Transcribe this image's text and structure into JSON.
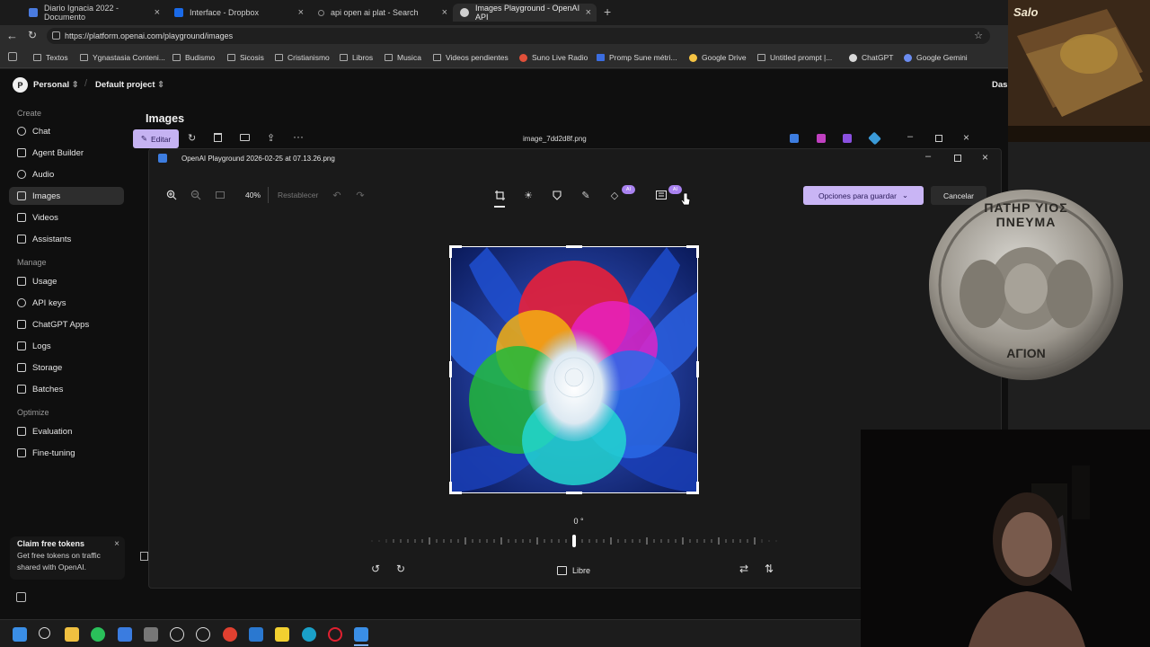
{
  "browser": {
    "tabs": [
      {
        "label": "Diario Ignacia 2022 - Documento",
        "color": "#4a7be0"
      },
      {
        "label": "Interface - Dropbox",
        "color": "#1a6ae8"
      },
      {
        "label": "api open ai plat - Search",
        "color": "#3a3a3a"
      },
      {
        "label": "Images Playground - OpenAI API",
        "color": "#7a7a7a"
      }
    ],
    "url": "https://platform.openai.com/playground/images",
    "bookmarks": [
      "Textos",
      "Ygnastasia Conteni...",
      "Budismo",
      "Sicosis",
      "Cristianismo",
      "Libros",
      "Musica",
      "Videos pendientes",
      "Suno Live Radio",
      "Promp Sune métri...",
      "Google Drive",
      "Untitled prompt |...",
      "ChatGPT",
      "Google Gemini"
    ]
  },
  "topnav": {
    "avatar_letter": "P",
    "org": "Personal",
    "project": "Default project",
    "right_text": "Dasl"
  },
  "sidebar": {
    "create_heading": "Create",
    "create_items": [
      "Chat",
      "Agent Builder",
      "Audio",
      "Images",
      "Videos",
      "Assistants"
    ],
    "manage_heading": "Manage",
    "manage_items": [
      "Usage",
      "API keys",
      "ChatGPT Apps",
      "Logs",
      "Storage",
      "Batches"
    ],
    "optimize_heading": "Optimize",
    "optimize_items": [
      "Evaluation",
      "Fine-tuning"
    ],
    "claim": {
      "title": "Claim free tokens",
      "body": "Get free tokens on traffic shared with OpenAI."
    }
  },
  "images": {
    "title": "Images",
    "edit_label": "Editar",
    "filename": "image_7dd2d8f.png"
  },
  "editor": {
    "window_title": "OpenAI Playground 2026-02-25 at 07.13.26.png",
    "zoom": "40%",
    "reset_label": "Restablecer",
    "ai_badge": "AI",
    "save_options_label": "Opciones para guardar",
    "cancel_label": "Cancelar",
    "rotation_readout": "0 °",
    "aspect_label": "Libre"
  },
  "overlays": {
    "coin_inscription_top": "ΠΑΤΗΡ ΥΙΟΣ ΠΝΕΥΜΑ",
    "coin_inscription_bottom": "ΑΓΙΟΝ",
    "salo_label": "Salo"
  },
  "colors": {
    "accent_purple": "#c9b5f5",
    "page_bg": "#0f0f0f"
  }
}
